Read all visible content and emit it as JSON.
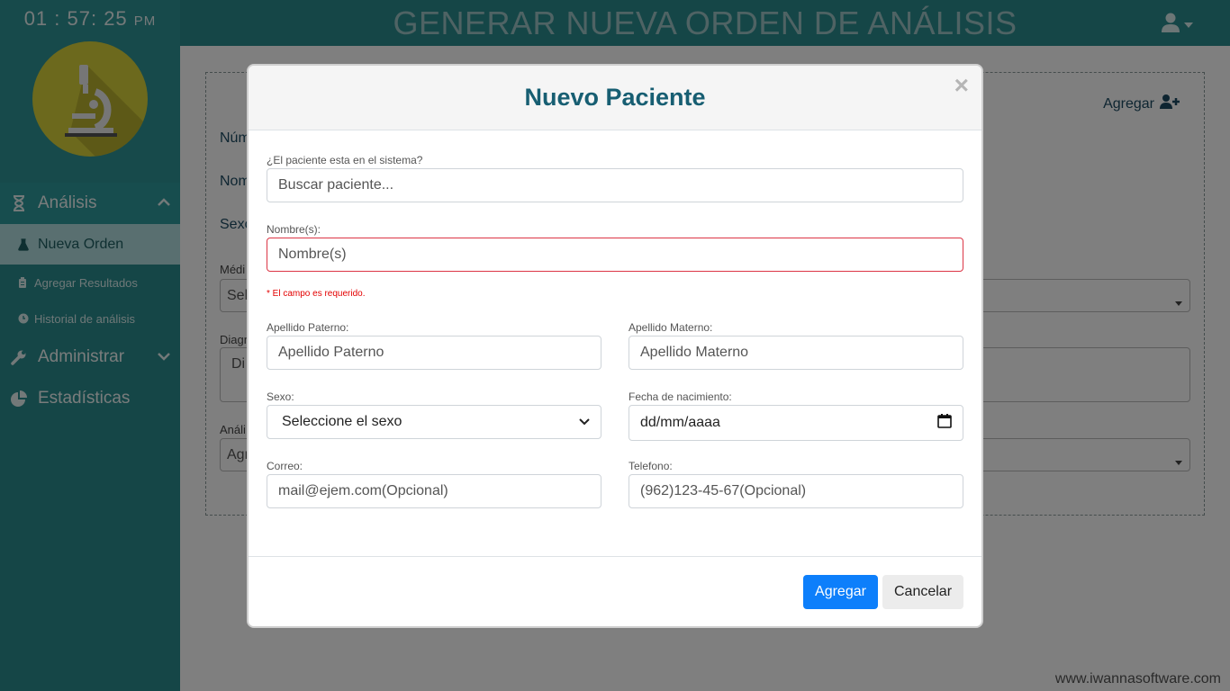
{
  "clock": {
    "time": "01 : 57: 25",
    "ampm": "PM"
  },
  "header": {
    "title": "GENERAR NUEVA ORDEN DE ANÁLISIS"
  },
  "sidebar": {
    "analisis": "Análisis",
    "nueva_orden": "Nueva Orden",
    "agregar_resultados": "Agregar Resultados",
    "historial": "Historial de análisis",
    "administrar": "Administrar",
    "estadisticas": "Estadísticas"
  },
  "background": {
    "agregar": "Agregar",
    "num": "Núm",
    "nom": "Nom",
    "sexo": "Sexo",
    "medico": "Médi",
    "sel": "Sel",
    "diag": "Diagn",
    "di": "Di",
    "anal": "Análi",
    "agr": "Agr",
    "watermark": "www.iwannasoftware.com"
  },
  "modal": {
    "title": "Nuevo Paciente",
    "close": "×",
    "search_label": "¿El paciente esta en el sistema?",
    "search_placeholder": "Buscar paciente...",
    "nombre_label": "Nombre(s):",
    "nombre_placeholder": "Nombre(s)",
    "nombre_error": "* El campo es requerido.",
    "ap_paterno_label": "Apellido Paterno:",
    "ap_paterno_placeholder": "Apellido Paterno",
    "ap_materno_label": "Apellido Materno:",
    "ap_materno_placeholder": "Apellido Materno",
    "sexo_label": "Sexo:",
    "sexo_value": "Seleccione el sexo",
    "fecha_label": "Fecha de nacimiento:",
    "fecha_value": "dd/mm/aaaa",
    "correo_label": "Correo:",
    "correo_placeholder": "mail@ejem.com(Opcional)",
    "telefono_label": "Telefono:",
    "telefono_placeholder": "(962)123-45-67(Opcional)",
    "agregar_button": "Agregar",
    "cancelar_button": "Cancelar"
  },
  "colors": {
    "sidebar": "#2b8d8f",
    "primary": "#0d7ffb",
    "title": "#175e72",
    "error": "#dc3545"
  }
}
